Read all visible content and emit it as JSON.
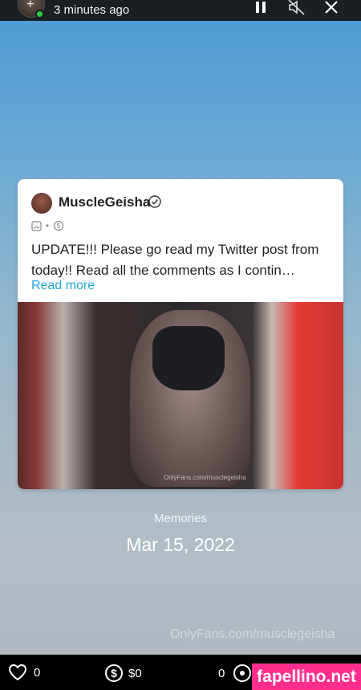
{
  "header": {
    "time_ago": "3 minutes ago"
  },
  "post": {
    "author": "MuscleGeisha",
    "text": "UPDATE!!! Please go read my Twitter post from today!! Read all the comments as I contin…",
    "read_more": "Read more",
    "media_watermark": "OnlyFans.com/musclegeisha"
  },
  "memory": {
    "label": "Memories",
    "date": "Mar 15, 2022"
  },
  "watermark": "OnlyFans.com/musclegeisha",
  "footer": {
    "likes": "0",
    "tips": "$0",
    "views": "0"
  },
  "badge": "fapellino.net",
  "colors": {
    "accent_link": "#1fa5d9",
    "online": "#2ecc40",
    "badge_bg": "#ff2e8d"
  },
  "icons": [
    "pause-icon",
    "mute-icon",
    "close-icon",
    "heart-icon",
    "dollar-icon",
    "eye-icon",
    "verified-icon"
  ]
}
